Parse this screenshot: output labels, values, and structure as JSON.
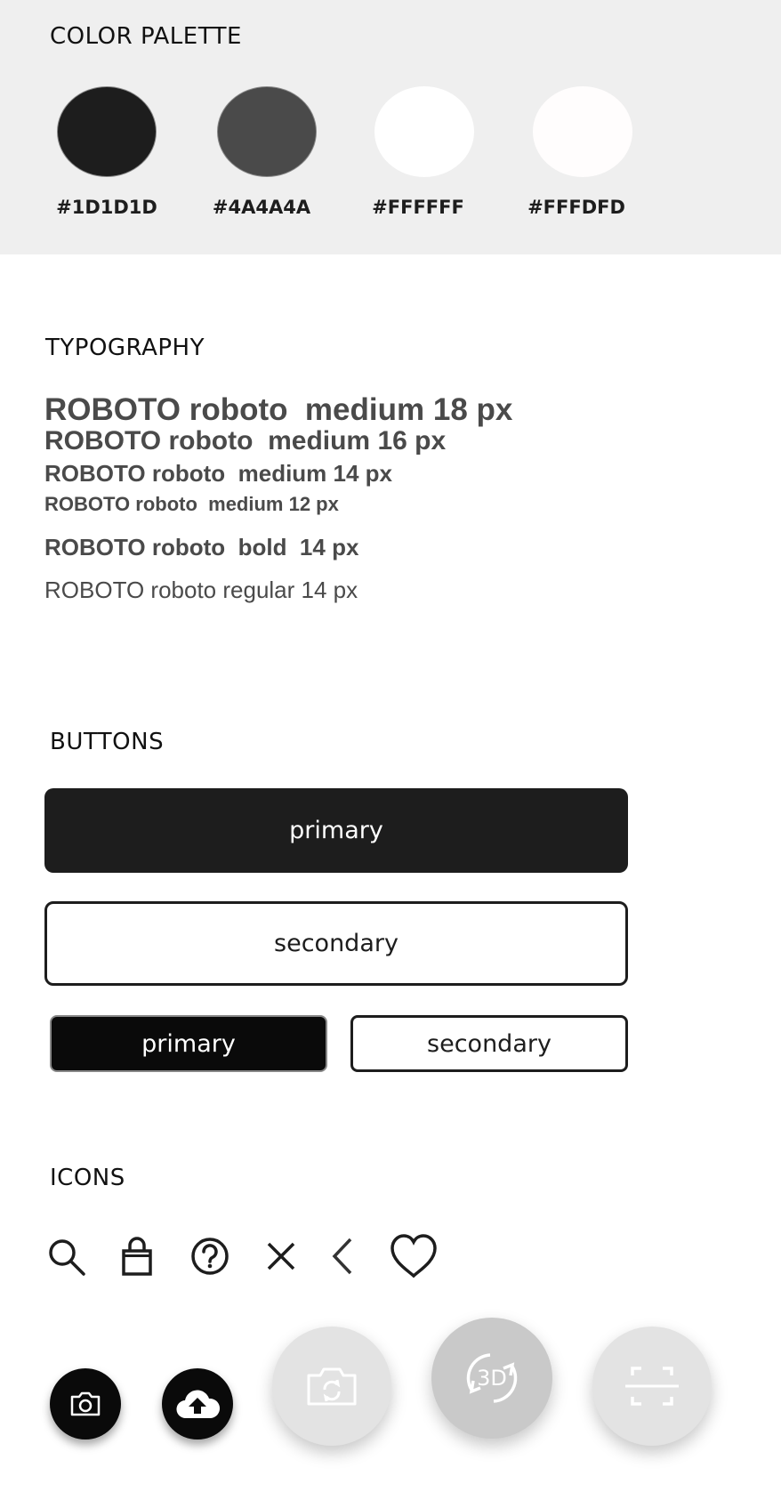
{
  "palette": {
    "title": "COLOR PALETTE",
    "swatches": [
      {
        "hex": "#1D1D1D",
        "label": "#1D1D1D"
      },
      {
        "hex": "#4A4A4A",
        "label": "#4A4A4A"
      },
      {
        "hex": "#FFFFFF",
        "label": "#FFFFFF"
      },
      {
        "hex": "#FFFDFD",
        "label": "#FFFDFD"
      }
    ]
  },
  "typography": {
    "title": "TYPOGRAPHY",
    "lines": [
      "ROBOTO roboto  medium 18 px",
      "ROBOTO roboto  medium 16 px",
      "ROBOTO roboto  medium 14 px",
      "ROBOTO roboto  medium 12 px",
      "ROBOTO roboto  bold  14 px",
      "ROBOTO roboto regular 14 px"
    ]
  },
  "buttons": {
    "title": "BUTTONS",
    "large_primary": "primary",
    "large_secondary": "secondary",
    "small_primary": "primary",
    "small_secondary": "secondary"
  },
  "icons": {
    "title": "ICONS",
    "row": [
      "search-icon",
      "shopping-bag-icon",
      "help-icon",
      "close-icon",
      "chevron-left-icon",
      "heart-icon"
    ],
    "fabs": [
      "camera-icon",
      "cloud-upload-icon",
      "camera-switch-icon",
      "rotate-3d-icon",
      "scan-icon"
    ],
    "fab_3d_text": "3D"
  },
  "colors": {
    "primary": "#1D1D1D",
    "secondary": "#4A4A4A",
    "background": "#FFFFFF",
    "palette_band": "#EFEFEF"
  }
}
